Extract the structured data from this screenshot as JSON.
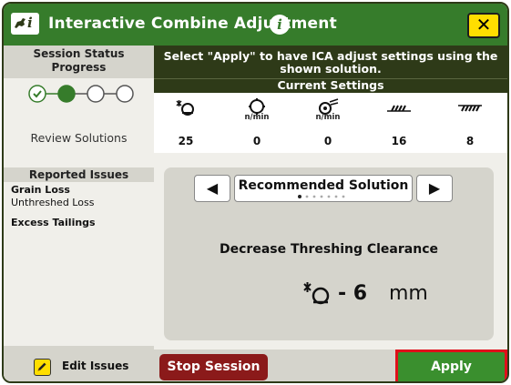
{
  "window": {
    "title": "Interactive Combine Adjustment",
    "app_icon": "john-deere-icon",
    "info_icon": "info-icon",
    "close_label": "✕"
  },
  "left_panel": {
    "session_status_label": "Session Status",
    "progress_label": "Progress",
    "progress": {
      "total_steps": 4,
      "completed_steps": 1,
      "current_step": 2
    },
    "current_step_label": "Review Solutions",
    "reported_issues_label": "Reported Issues",
    "issues": [
      {
        "title": "Grain Loss",
        "detail": "Unthreshed Loss"
      },
      {
        "title": "Excess Tailings",
        "detail": ""
      }
    ],
    "edit_issues_label": "Edit Issues"
  },
  "instruction": "Select \"Apply\" to have ICA adjust settings using the shown solution.",
  "current_settings": {
    "label": "Current Settings",
    "items": [
      {
        "icon": "threshing-clearance-icon",
        "unit": "",
        "value": "25"
      },
      {
        "icon": "rotor-speed-icon",
        "unit": "n/min",
        "value": "0"
      },
      {
        "icon": "fan-speed-icon",
        "unit": "n/min",
        "value": "0"
      },
      {
        "icon": "chaffer-icon",
        "unit": "",
        "value": "16"
      },
      {
        "icon": "sieve-icon",
        "unit": "",
        "value": "8"
      }
    ]
  },
  "solution": {
    "header": "Recommended Solution",
    "page_index": 1,
    "page_count": 7,
    "description": "Decrease Threshing Clearance",
    "icon": "threshing-clearance-icon",
    "value": "- 6",
    "unit": "mm"
  },
  "buttons": {
    "stop_session": "Stop Session",
    "apply": "Apply"
  },
  "colors": {
    "brand_green": "#367c2b",
    "dark_header": "#2e3a18",
    "accent_yellow": "#ffde00",
    "stop_red": "#8b1a1a",
    "apply_green": "#3a8f2e",
    "highlight_red": "#e0101a"
  }
}
